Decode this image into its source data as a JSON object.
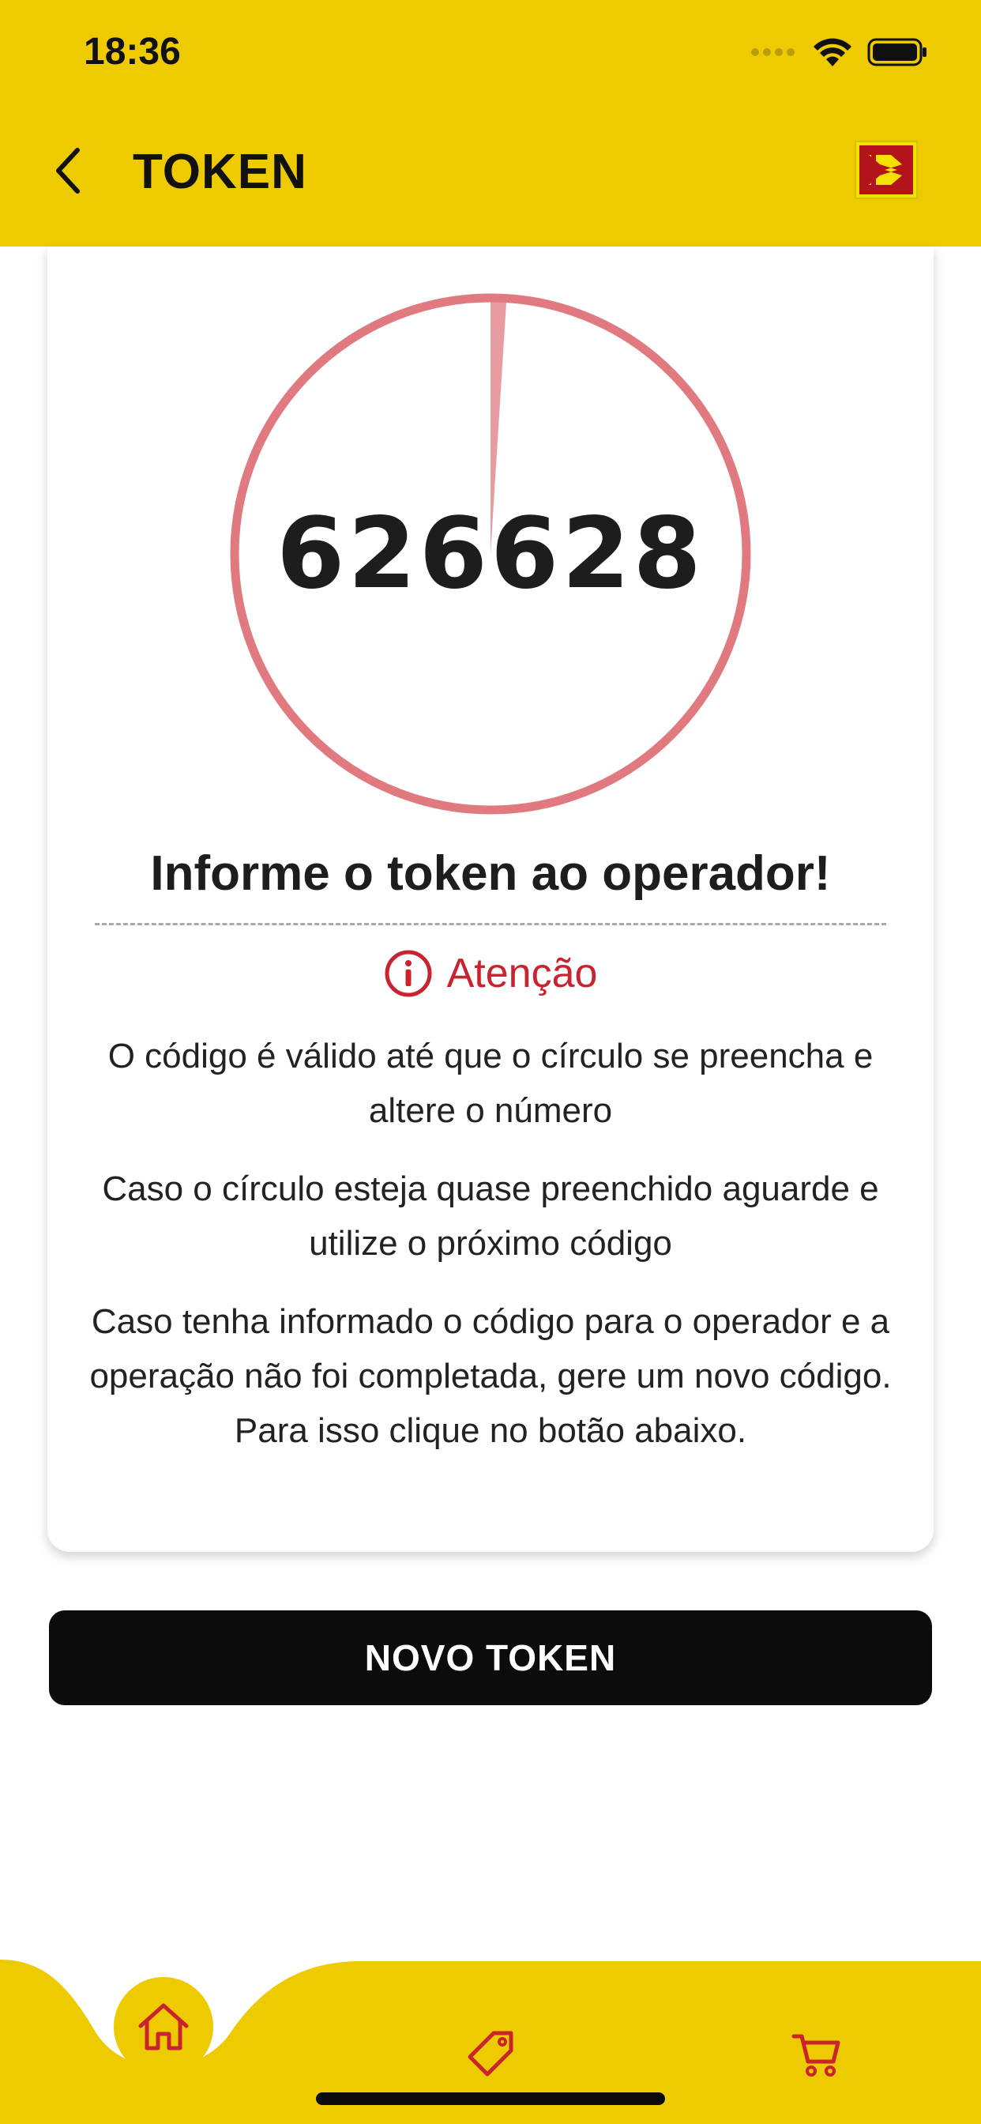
{
  "status_bar": {
    "time": "18:36",
    "icons": [
      "signal-icon",
      "wifi-icon",
      "battery-icon"
    ]
  },
  "header": {
    "back_icon": "chevron-left-icon",
    "title": "TOKEN",
    "logo": "brand-logo"
  },
  "token": {
    "code": "626628",
    "timer_progress": 0.01
  },
  "card": {
    "instruction": "Informe o token ao operador!",
    "attention_icon": "info-icon",
    "attention_label": "Atenção",
    "notes": [
      "O código é válido até que o círculo se preencha e altere o número",
      "Caso o círculo esteja quase preenchido aguarde e utilize o próximo código",
      "Caso tenha informado o código para o operador e a operação não foi completada, gere um novo código. Para isso clique no botão abaixo."
    ]
  },
  "actions": {
    "new_token_label": "NOVO TOKEN"
  },
  "tabbar": {
    "items": [
      {
        "icon": "home-icon",
        "active": true
      },
      {
        "icon": "tag-icon",
        "active": false
      },
      {
        "icon": "cart-icon",
        "active": false
      }
    ]
  },
  "colors": {
    "brand_yellow": "#eecb00",
    "accent_red": "#c9232f",
    "ring_red": "#e07a80",
    "button_black": "#0c0c0c"
  }
}
